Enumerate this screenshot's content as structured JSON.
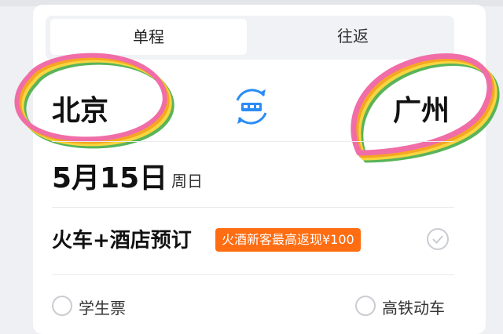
{
  "trip_tabs": {
    "one_way": "单程",
    "round_trip": "往返"
  },
  "route": {
    "from_city": "北京",
    "to_city": "广州"
  },
  "travel_date": {
    "date": "5月15日",
    "weekday": "周日"
  },
  "combo": {
    "label": "火车+酒店预订",
    "promo": "火酒新客最高返现¥100"
  },
  "options": {
    "student_ticket": "学生票",
    "high_speed": "高铁动车"
  },
  "colors": {
    "accent_blue": "#2a8cf5",
    "promo_orange": "#ff6d12",
    "ribbon": [
      "#f06da7",
      "#f5a623",
      "#f7d53f",
      "#5ab45a"
    ]
  },
  "icons": {
    "swap": "swap-train-icon",
    "check": "check-circle-icon"
  }
}
